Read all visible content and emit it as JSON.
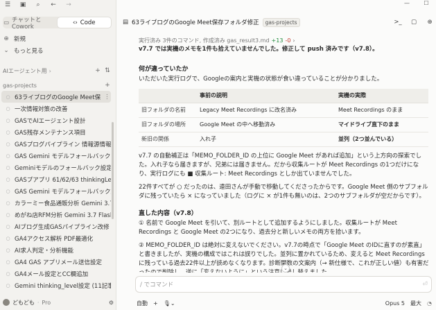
{
  "sidebar": {
    "mode_tabs": [
      "チャットとCowork",
      "Code"
    ],
    "nav": {
      "new": "新規",
      "more": "もっと見る"
    },
    "section_environment": "AIエージェント用",
    "section_project": "gas-projects",
    "sessions": [
      "63ライブログのGoogle Meet保存フォルダ修正",
      "一次情報対策の改善",
      "GASでAIエージェント設計",
      "GAS残存メンテナンス項目",
      "GASプログパイプライン 情報源情報評価",
      "GAS Gemini モデルフォールバック",
      "Geminiモデルのフォールバック設定",
      "GASプアプリ 61/62/63 thinkingLevel対応",
      "GAS Gemini モデルフォールバック対応",
      "カラーミー食品通販分析 Gemini 3.7対応",
      "めがね店RFM分析 Gemini 3.7 Flash移行",
      "AIブログ生成GASパイプライン改修",
      "GA4アクセス解析 PDF最適化",
      "AI求人判定・分析機能",
      "GA4 GAS アプリメール送信設定",
      "GA4メール設定とCC欄追加",
      "Gemini thinking_level設定 (11記事作成)"
    ],
    "user": "どもども",
    "plan": "Pro"
  },
  "header": {
    "title": "63ライブログのGoogle Meet保存フォルダ修正",
    "badge": "gas-projects"
  },
  "content": {
    "status_prefix": "実行済み 3件のコマンド, 作成済み gas_result3.md",
    "status_plus": "+13",
    "status_minus": "-0",
    "intro": "v7.7 では実機のメモを1件も拾えていませんでした。修正して push 済みです（v7.8）。",
    "h_diff": "何が違っていたか",
    "diff_intro": "いただいた実行ログで、Googleの案内と実機の状態が食い違っていることが分かりました。",
    "table_headers": [
      "",
      "事前の説明",
      "実機の実際"
    ],
    "table_rows": [
      [
        "旧フォルダの名前",
        "Legacy Meet Recordings に改名済み",
        "Meet Recordings のまま"
      ],
      [
        "旧フォルダの場所",
        "Google Meet の中へ移動済み",
        "マイドライブ直下のまま"
      ],
      [
        "新旧の関係",
        "入れ子",
        "並列（2つ並んでいる）"
      ]
    ],
    "para_search": "v7.7 の自動補正は「MEMO_FOLDER_ID の上位に Google Meet があれば追加」という上方向の探索でした。入れ子なら届きますが、兄弟には届きません。だから収集ルートが Meet Recordings の1つだけになり、実行ログにも ■ 収集ルート: Meet Recordings としか出ていませんでした。",
    "para_22": "22件すべてが ○ だったのは、遠田さんが手動で移動してくださったからです。Google Meet 側のサブフォルダに残っていたら × になっていました（ログに × が1件も無いのは、2つのサブフォルダが空だからです）。",
    "h_fixed": "直した内容（v7.8）",
    "fix1": "① 名前で Google Meet を引いて、別ルートとして追加するようにしました。収集ルートが Meet Recordings と Google Meet の2つになり、過去分と新しいメモの両方を拾います。",
    "fix2": "② MEMO_FOLDER_ID は絶対に変えないでください。v7.7の時点で「Google Meet のIDに直すのが素直」と書きましたが、実機の構成ではこれは誤りでした。並列に置かれているため、変えると Meet Recordings に残っている過去22件以上が読めなくなります。診断関数の文案内（→ 新仕様で、これが正しい値）も有害だったので削除し、逆に「変えないように」という注意に差し替えました。"
  },
  "composer": {
    "placeholder": "/ でコマンド",
    "mode": "自動",
    "model": "Opus 5",
    "effort": "最大"
  }
}
